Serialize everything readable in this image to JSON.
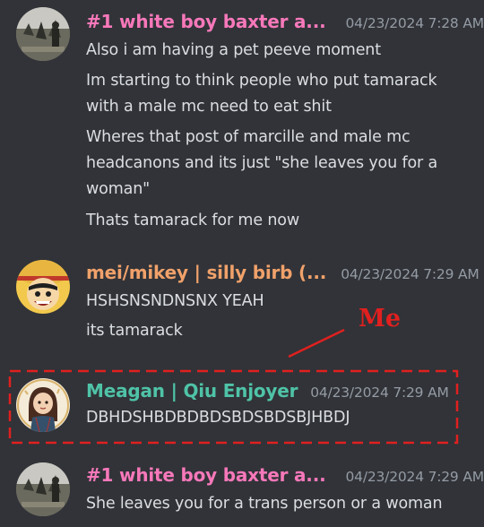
{
  "colors": {
    "background": "#313338",
    "text": "#dbdee1",
    "timestamp": "#949ba4",
    "user_pink": "#f778ba",
    "user_orange": "#f0a16a",
    "user_teal": "#4fc3a7",
    "annotation_red": "#e0201f"
  },
  "messages": [
    {
      "username": "#1 white boy baxter a...",
      "timestamp": "04/23/2024 7:28 AM",
      "lines": [
        "Also i am having a pet peeve moment",
        "Im starting to think people who put tamarack",
        "with a male mc need to eat shit",
        "Wheres that post of marcille and male mc",
        "headcanons and its just \"she leaves you for a",
        "woman\"",
        "Thats tamarack for me now"
      ]
    },
    {
      "username": "mei/mikey | silly birb (...",
      "timestamp": "04/23/2024 7:29 AM",
      "lines": [
        "HSHSNSNDNSNX YEAH",
        "its tamarack"
      ]
    },
    {
      "username": "Meagan | Qiu Enjoyer",
      "timestamp": "04/23/2024 7:29 AM",
      "lines": [
        "DBHDSHBDBDBDSBDSBDSBJHBDJ"
      ]
    },
    {
      "username": "#1 white boy baxter a...",
      "timestamp": "04/23/2024 7:29 AM",
      "lines": [
        "She leaves you for a trans person or a woman"
      ]
    }
  ],
  "annotation": {
    "label": "Me"
  }
}
